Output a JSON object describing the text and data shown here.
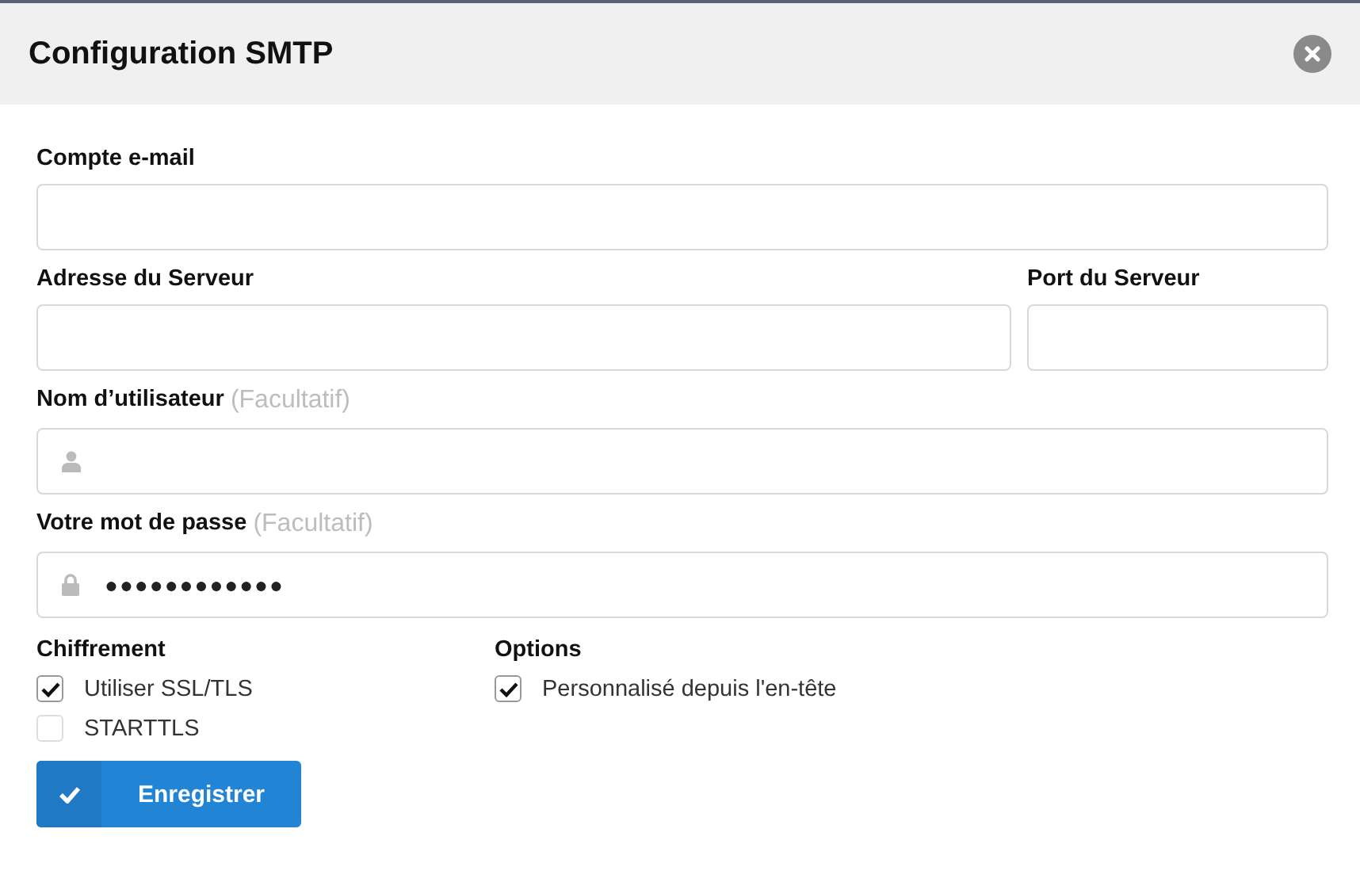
{
  "dialog": {
    "title": "Configuration SMTP"
  },
  "rows": [
    [
      {
        "label": "Compte e-mail",
        "kind": "text"
      }
    ],
    [
      {
        "label": "Adresse du Serveur",
        "kind": "text"
      },
      {
        "label": "Port du Serveur",
        "kind": "narrow"
      }
    ],
    [
      {
        "label": "Nom d’utilisateur",
        "hint": "(Facultatif)",
        "kind": "user"
      }
    ],
    [
      {
        "label": "Votre mot de passe",
        "hint": "(Facultatif)",
        "kind": "password",
        "value": "●●●●●●●●●●●●"
      }
    ]
  ],
  "groups": [
    {
      "title": "Chiffrement",
      "options": [
        {
          "label": "Utiliser SSL/TLS",
          "checked": true
        },
        {
          "label": "STARTTLS",
          "checked": false
        }
      ]
    },
    {
      "title": "Options",
      "options": [
        {
          "label": "Personnalisé depuis l'en-tête",
          "checked": true
        }
      ]
    }
  ],
  "save_button": {
    "label": "Enregistrer"
  }
}
